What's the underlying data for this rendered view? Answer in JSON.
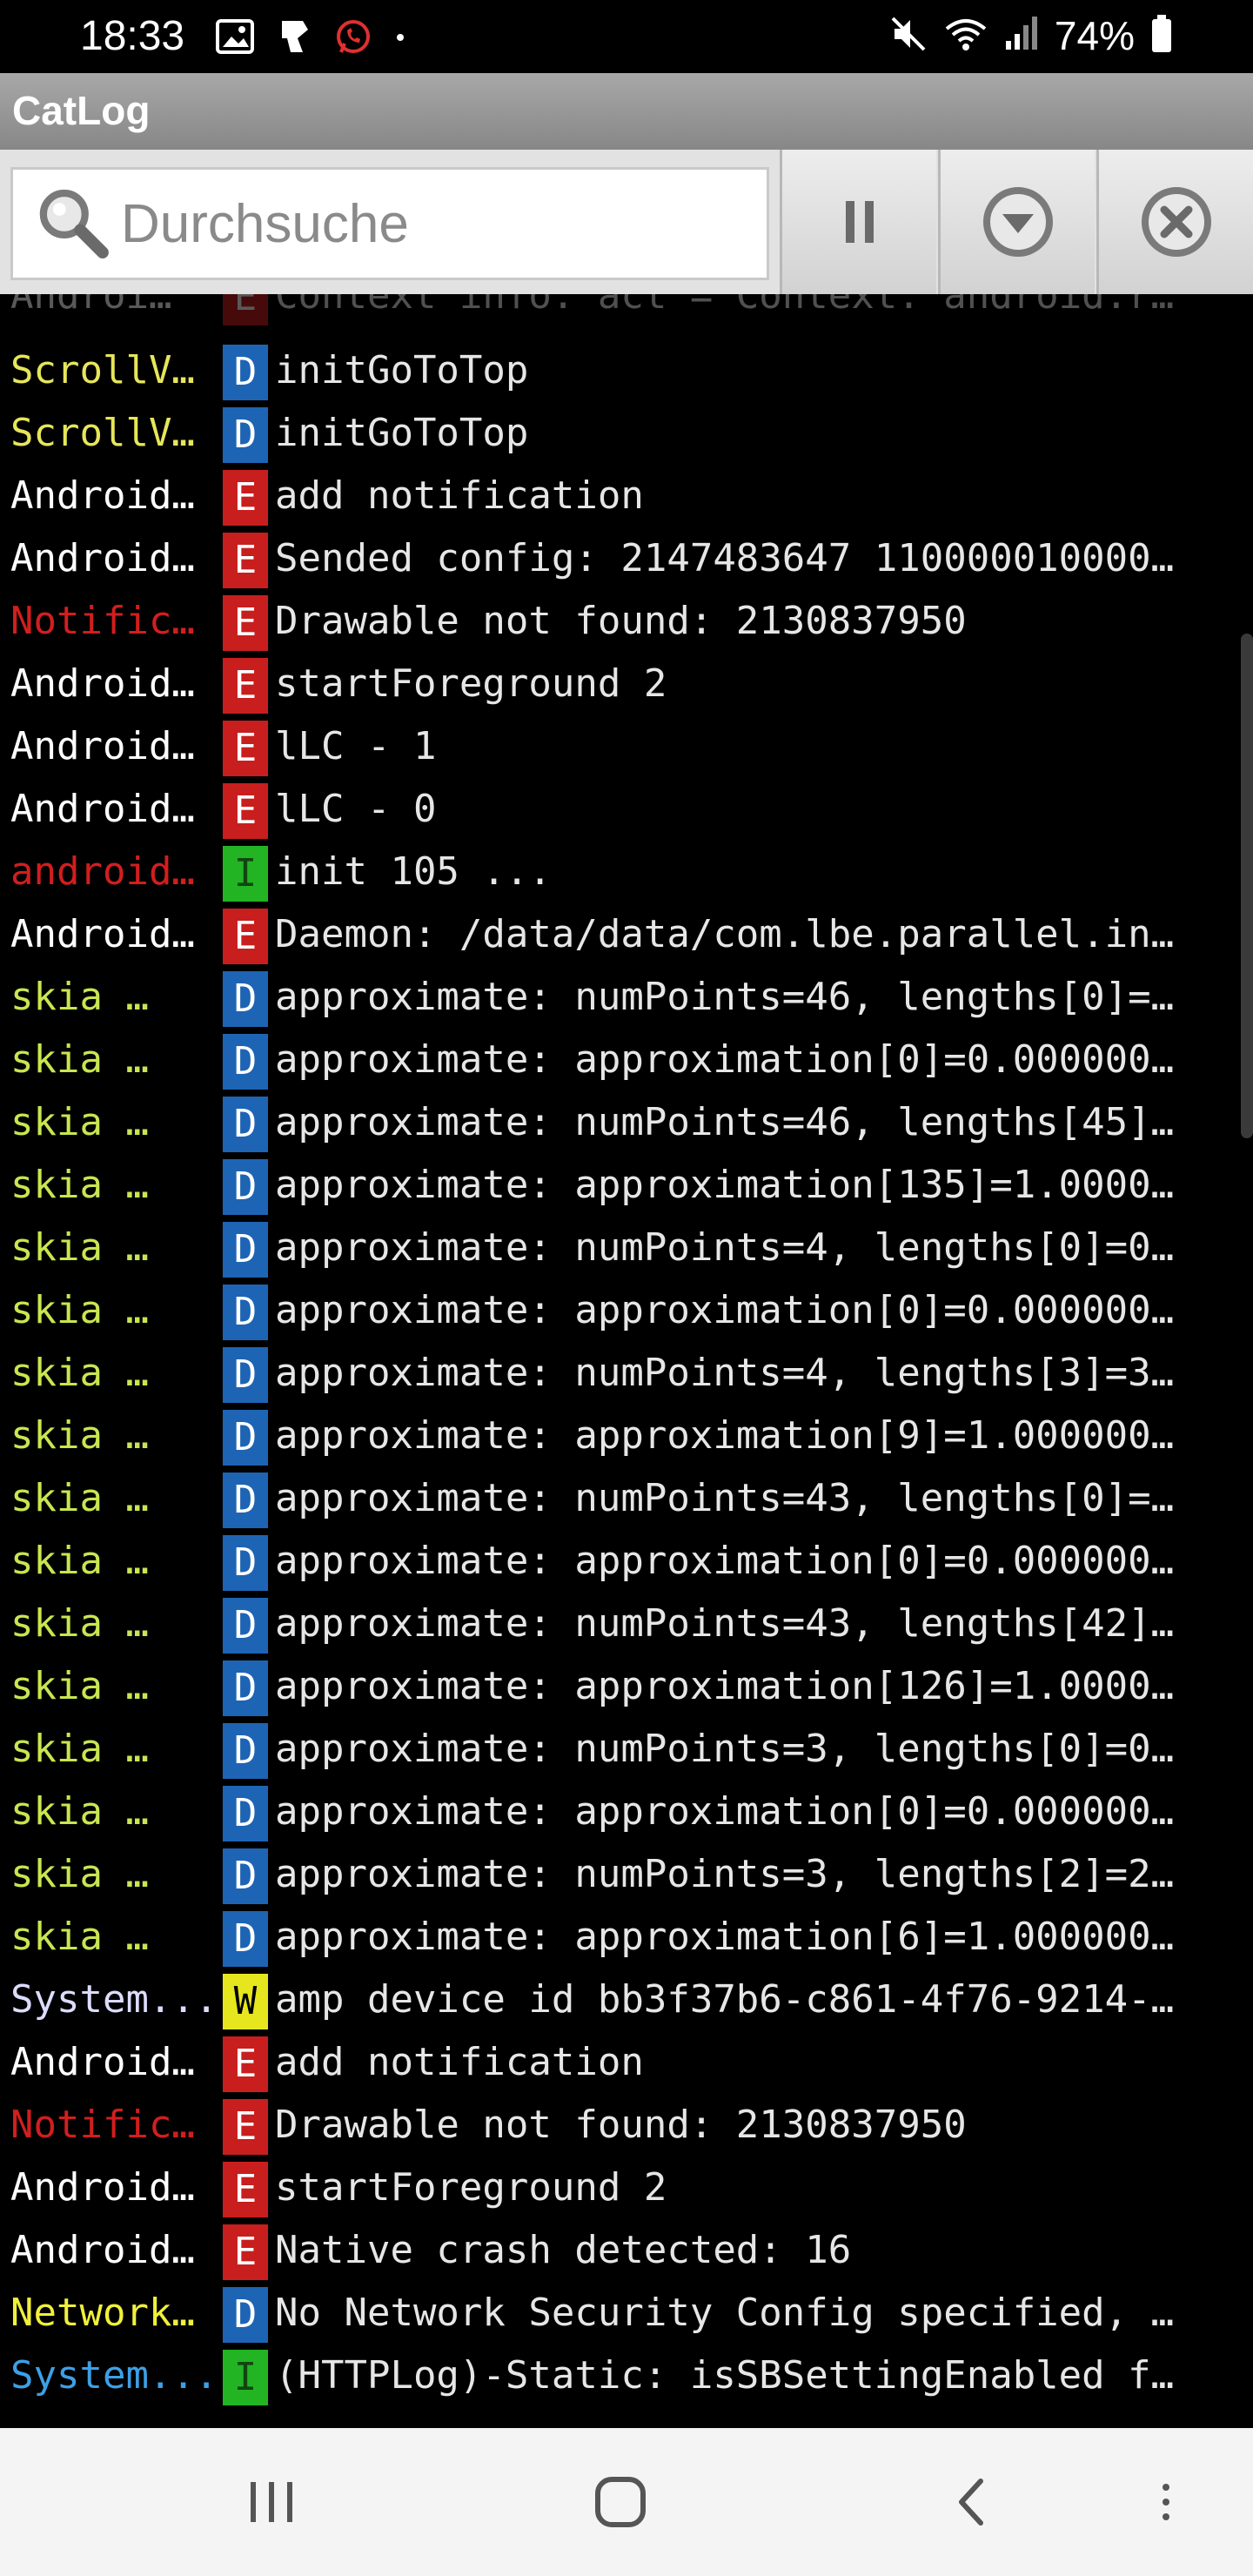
{
  "status_bar": {
    "time": "18:33",
    "battery": "74%",
    "icons_left": [
      "image-icon",
      "app-icon",
      "whatsapp-icon",
      "dot-icon"
    ],
    "icons_right": [
      "mute-icon",
      "wifi-icon",
      "signal-icon",
      "battery-icon"
    ]
  },
  "app": {
    "title": "CatLog"
  },
  "search": {
    "placeholder": "Durchsuche",
    "value": ""
  },
  "toolbar": {
    "buttons": [
      "pause-button",
      "filter-button",
      "clear-button"
    ]
  },
  "colors": {
    "D": "#1e64b4",
    "E": "#c81e1e",
    "I": "#22b422",
    "W": "#e6e61e"
  },
  "partial_row": {
    "tag": "Androi…",
    "level": "E",
    "message": "Context info: act = Context: android.r…"
  },
  "rows": [
    {
      "tag": "ScrollV…",
      "tag_color": "#e6e65a",
      "level": "D",
      "message": "initGoToTop"
    },
    {
      "tag": "ScrollV…",
      "tag_color": "#e6e65a",
      "level": "D",
      "message": "initGoToTop"
    },
    {
      "tag": "Android…",
      "tag_color": "#ffffff",
      "level": "E",
      "message": "add notification"
    },
    {
      "tag": "Android…",
      "tag_color": "#ffffff",
      "level": "E",
      "message": "Sended config: 2147483647 110000010000…"
    },
    {
      "tag": "Notific…",
      "tag_color": "#d21e1e",
      "level": "E",
      "message": "Drawable not found: 2130837950"
    },
    {
      "tag": "Android…",
      "tag_color": "#ffffff",
      "level": "E",
      "message": "startForeground 2"
    },
    {
      "tag": "Android…",
      "tag_color": "#ffffff",
      "level": "E",
      "message": "lLC - 1"
    },
    {
      "tag": "Android…",
      "tag_color": "#ffffff",
      "level": "E",
      "message": "lLC - 0"
    },
    {
      "tag": "android…",
      "tag_color": "#d21e1e",
      "level": "I",
      "message": "init 105 ..."
    },
    {
      "tag": "Android…",
      "tag_color": "#ffffff",
      "level": "E",
      "message": "Daemon: /data/data/com.lbe.parallel.in…"
    },
    {
      "tag": "skia    …",
      "tag_color": "#c8e650",
      "level": "D",
      "message": "approximate: numPoints=46, lengths[0]=…"
    },
    {
      "tag": "skia    …",
      "tag_color": "#c8e650",
      "level": "D",
      "message": "approximate: approximation[0]=0.000000…"
    },
    {
      "tag": "skia    …",
      "tag_color": "#c8e650",
      "level": "D",
      "message": "approximate: numPoints=46, lengths[45]…"
    },
    {
      "tag": "skia    …",
      "tag_color": "#c8e650",
      "level": "D",
      "message": "approximate: approximation[135]=1.0000…"
    },
    {
      "tag": "skia    …",
      "tag_color": "#c8e650",
      "level": "D",
      "message": "approximate: numPoints=4, lengths[0]=0…"
    },
    {
      "tag": "skia    …",
      "tag_color": "#c8e650",
      "level": "D",
      "message": "approximate: approximation[0]=0.000000…"
    },
    {
      "tag": "skia    …",
      "tag_color": "#c8e650",
      "level": "D",
      "message": "approximate: numPoints=4, lengths[3]=3…"
    },
    {
      "tag": "skia    …",
      "tag_color": "#c8e650",
      "level": "D",
      "message": "approximate: approximation[9]=1.000000…"
    },
    {
      "tag": "skia    …",
      "tag_color": "#c8e650",
      "level": "D",
      "message": "approximate: numPoints=43, lengths[0]=…"
    },
    {
      "tag": "skia    …",
      "tag_color": "#c8e650",
      "level": "D",
      "message": "approximate: approximation[0]=0.000000…"
    },
    {
      "tag": "skia    …",
      "tag_color": "#c8e650",
      "level": "D",
      "message": "approximate: numPoints=43, lengths[42]…"
    },
    {
      "tag": "skia    …",
      "tag_color": "#c8e650",
      "level": "D",
      "message": "approximate: approximation[126]=1.0000…"
    },
    {
      "tag": "skia    …",
      "tag_color": "#c8e650",
      "level": "D",
      "message": "approximate: numPoints=3, lengths[0]=0…"
    },
    {
      "tag": "skia    …",
      "tag_color": "#c8e650",
      "level": "D",
      "message": "approximate: approximation[0]=0.000000…"
    },
    {
      "tag": "skia    …",
      "tag_color": "#c8e650",
      "level": "D",
      "message": "approximate: numPoints=3, lengths[2]=2…"
    },
    {
      "tag": "skia    …",
      "tag_color": "#c8e650",
      "level": "D",
      "message": "approximate: approximation[6]=1.000000…"
    },
    {
      "tag": "System...",
      "tag_color": "#dcdcff",
      "level": "W",
      "message": "amp device id bb3f37b6-c861-4f76-9214-…"
    },
    {
      "tag": "Android…",
      "tag_color": "#ffffff",
      "level": "E",
      "message": "add notification"
    },
    {
      "tag": "Notific…",
      "tag_color": "#d21e1e",
      "level": "E",
      "message": "Drawable not found: 2130837950"
    },
    {
      "tag": "Android…",
      "tag_color": "#ffffff",
      "level": "E",
      "message": "startForeground 2"
    },
    {
      "tag": "Android…",
      "tag_color": "#ffffff",
      "level": "E",
      "message": "Native crash detected: 16"
    },
    {
      "tag": "Network…",
      "tag_color": "#f0f03c",
      "level": "D",
      "message": "No Network Security Config specified, …"
    },
    {
      "tag": "System...",
      "tag_color": "#3ca0e6",
      "level": "I",
      "message": "(HTTPLog)-Static: isSBSettingEnabled f…"
    }
  ],
  "nav_bar": {
    "buttons": [
      "recents-button",
      "home-button",
      "back-button",
      "menu-button"
    ]
  }
}
